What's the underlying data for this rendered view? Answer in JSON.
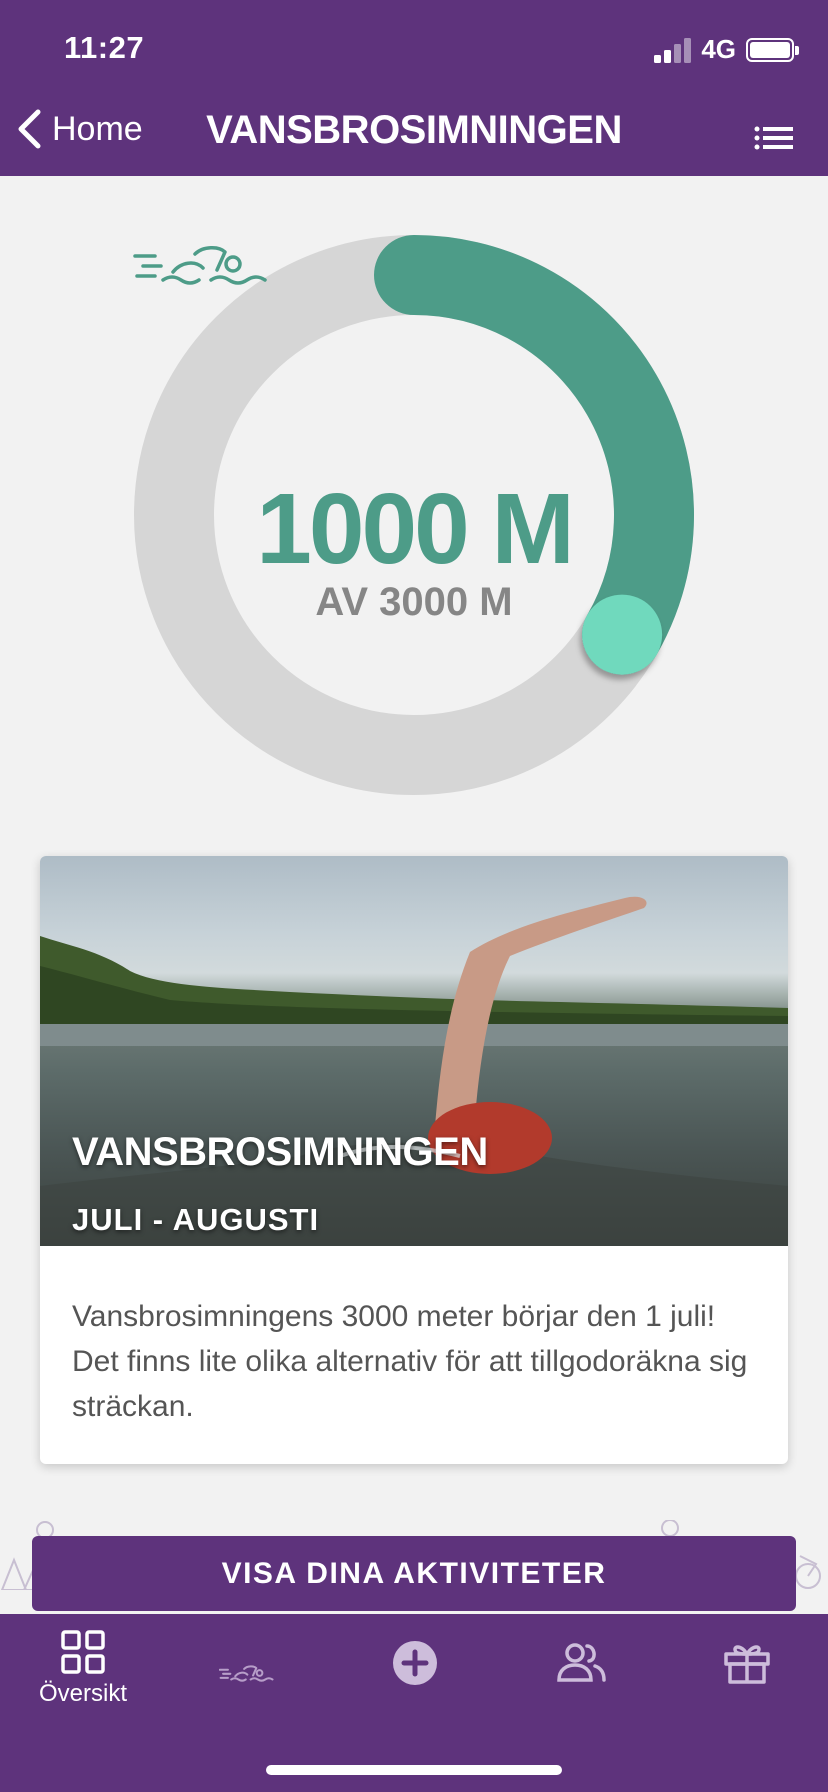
{
  "status_bar": {
    "time": "11:27",
    "network": "4G"
  },
  "nav": {
    "back_label": "Home",
    "title": "VANSBROSIMNINGEN"
  },
  "progress": {
    "value_label": "1000 M",
    "sub_label": "AV 3000 M",
    "current": 1000,
    "total": 3000,
    "fraction": 0.333,
    "track_color": "#d6d6d6",
    "progress_color": "#4d9c88",
    "progress_end_color": "#6fd9bd",
    "icon": "swimmer-icon"
  },
  "card": {
    "title": "VANSBROSIMNINGEN",
    "dates": "JULI - AUGUSTI",
    "description": "Vansbrosimningens 3000 meter börjar den 1 juli! Det finns lite olika alternativ för att tillgodoräkna sig sträckan."
  },
  "cta": {
    "label": "VISA DINA AKTIVITETER"
  },
  "tabs": [
    {
      "label": "Översikt",
      "icon": "grid-icon",
      "active": true
    },
    {
      "label": "",
      "icon": "swimmer-icon",
      "active": false
    },
    {
      "label": "",
      "icon": "plus-circle-icon",
      "active": false
    },
    {
      "label": "",
      "icon": "people-icon",
      "active": false
    },
    {
      "label": "",
      "icon": "gift-icon",
      "active": false
    }
  ],
  "colors": {
    "brand": "#5e337c",
    "background": "#f2f2f2",
    "accent": "#4d9c88"
  }
}
